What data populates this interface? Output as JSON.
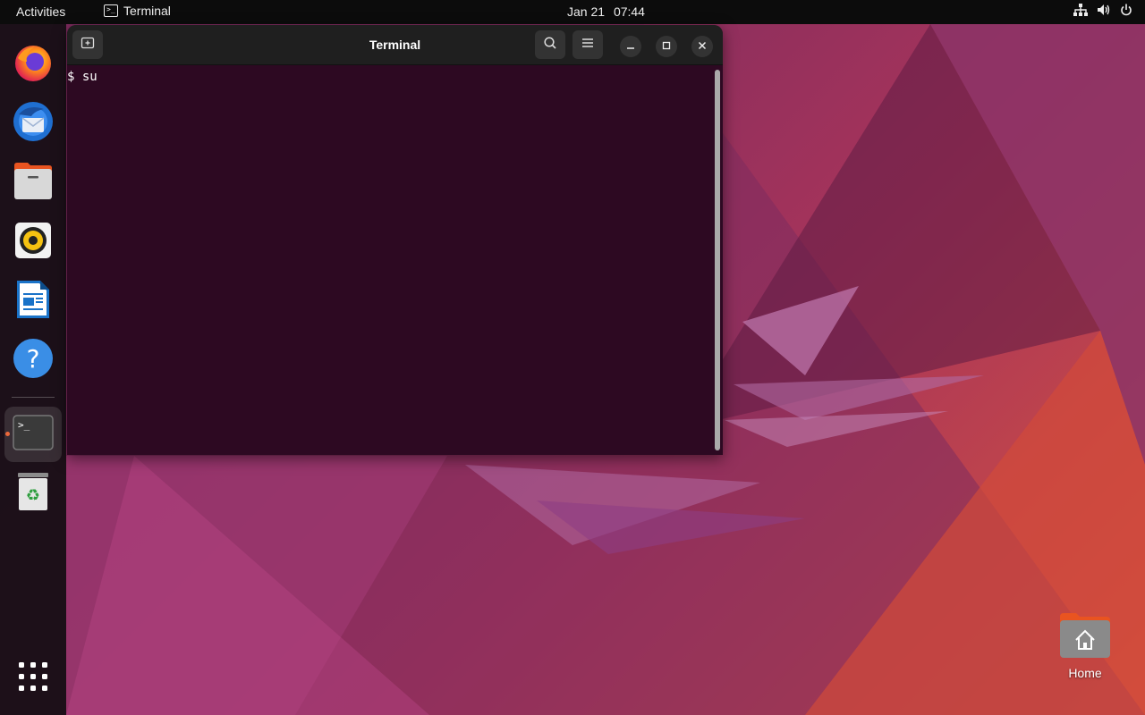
{
  "topbar": {
    "activities": "Activities",
    "app_name": "Terminal",
    "date": "Jan 21",
    "time": "07:44",
    "tray_icons": [
      "network-icon",
      "volume-icon",
      "power-icon"
    ]
  },
  "dock": {
    "items": [
      {
        "name": "firefox-icon",
        "label": "Firefox"
      },
      {
        "name": "thunderbird-icon",
        "label": "Thunderbird Mail"
      },
      {
        "name": "files-icon",
        "label": "Files"
      },
      {
        "name": "rhythmbox-icon",
        "label": "Rhythmbox"
      },
      {
        "name": "libreoffice-writer-icon",
        "label": "LibreOffice Writer"
      },
      {
        "name": "help-icon",
        "label": "Help"
      },
      {
        "name": "terminal-icon",
        "label": "Terminal",
        "running": true
      },
      {
        "name": "trash-icon",
        "label": "Trash"
      },
      {
        "name": "show-apps-icon",
        "label": "Show Applications"
      }
    ]
  },
  "terminal": {
    "title": "Terminal",
    "prompt": "$",
    "command": "su"
  },
  "desktop": {
    "home_label": "Home"
  },
  "colors": {
    "topbar": "#0c0c0c",
    "terminal_bg": "#2d0922",
    "header_bg": "#1f1f1f",
    "accent": "#e95420"
  }
}
